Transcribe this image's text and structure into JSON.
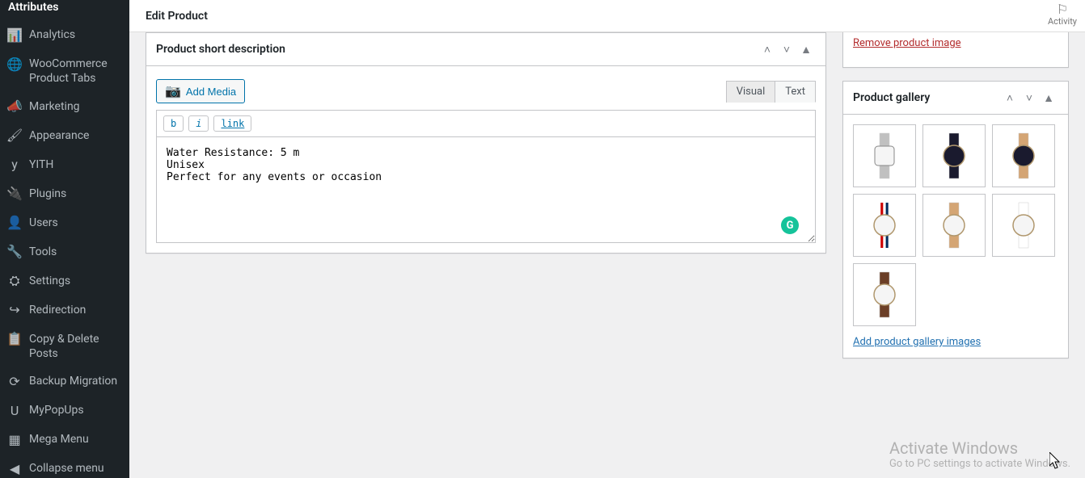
{
  "sidebar": {
    "current_sub": "Attributes",
    "items": [
      {
        "icon": "📊",
        "label": "Analytics"
      },
      {
        "icon": "🌐",
        "label": "WooCommerce Product Tabs"
      },
      {
        "icon": "📣",
        "label": "Marketing"
      },
      {
        "icon": "🖌",
        "label": "Appearance"
      },
      {
        "icon": "y",
        "label": "YITH"
      },
      {
        "icon": "🔌",
        "label": "Plugins"
      },
      {
        "icon": "👤",
        "label": "Users"
      },
      {
        "icon": "🔧",
        "label": "Tools"
      },
      {
        "icon": "⛭",
        "label": "Settings"
      },
      {
        "icon": "↪",
        "label": "Redirection"
      },
      {
        "icon": "📋",
        "label": "Copy & Delete Posts"
      },
      {
        "icon": "⟳",
        "label": "Backup Migration"
      },
      {
        "icon": "U",
        "label": "MyPopUps"
      },
      {
        "icon": "▦",
        "label": "Mega Menu"
      },
      {
        "icon": "◀",
        "label": "Collapse menu"
      }
    ]
  },
  "header": {
    "title": "Edit Product",
    "activity_label": "Activity"
  },
  "short_desc": {
    "panel_title": "Product short description",
    "add_media": "Add Media",
    "tab_visual": "Visual",
    "tab_text": "Text",
    "btn_b": "b",
    "btn_i": "i",
    "btn_link": "link",
    "content": "Water Resistance: 5 m\nUnisex\nPerfect for any events or occasion"
  },
  "product_image": {
    "remove_label": "Remove product image"
  },
  "gallery": {
    "panel_title": "Product gallery",
    "add_link": "Add product gallery images",
    "thumbs": [
      {
        "band": "#c0c0c0",
        "face": "#f5f5f5",
        "shape": "rect"
      },
      {
        "band": "#1a1a2e",
        "face": "#1a1a2e",
        "shape": "round"
      },
      {
        "band": "#d4a574",
        "face": "#1a1a2e",
        "shape": "round"
      },
      {
        "band": "stripe",
        "face": "#f5f5f5",
        "shape": "round"
      },
      {
        "band": "#d4a574",
        "face": "#f5f5f5",
        "shape": "round"
      },
      {
        "band": "#ffffff",
        "face": "#f5f5f5",
        "shape": "round"
      },
      {
        "band": "#6b3e26",
        "face": "#f5f5f5",
        "shape": "round"
      }
    ]
  },
  "watermark": {
    "line1": "Activate Windows",
    "line2": "Go to PC settings to activate Windows."
  }
}
